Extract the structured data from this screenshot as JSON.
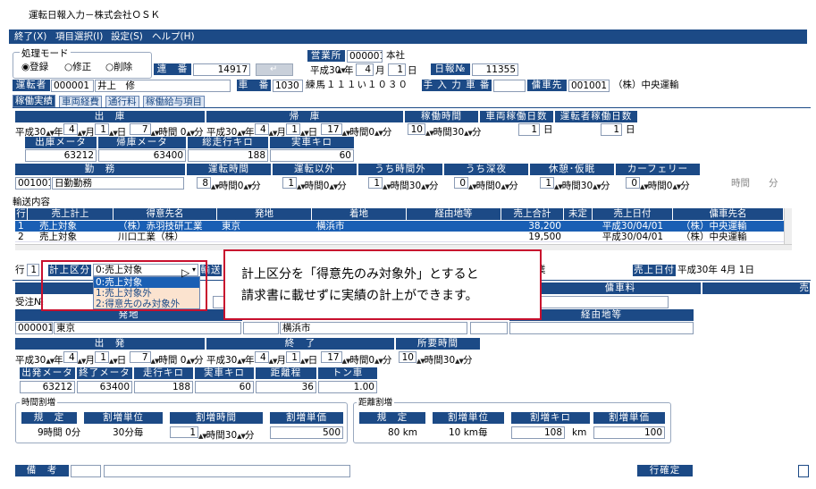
{
  "app": {
    "title": "運転日報入力－株式会社ＯＳＫ"
  },
  "menu": [
    "終了(X)",
    "項目選択(I)",
    "設定(S)",
    "ヘルプ(H)"
  ],
  "mode": {
    "label": "処理モード",
    "opts": [
      "◉登録",
      "○修正",
      "○削除"
    ],
    "serial_label": "連　番",
    "serial": "14917"
  },
  "office": {
    "label": "営業所",
    "code": "000001",
    "name": "本社"
  },
  "date": {
    "era": "平成30",
    "y": "年",
    "m": "4",
    "mu": "月",
    "d": "1",
    "du": "日",
    "report_label": "日報№",
    "report_no": "11355"
  },
  "driver": {
    "label": "運転者",
    "code": "000001",
    "name": "井上　修",
    "car_label": "車　番",
    "car_code": "1030",
    "car_name": "練馬１１１い１０３０",
    "manual_label": "手 入 力 車 番",
    "hire_label": "傭車先",
    "hire_code": "001001",
    "hire_name": "（株）中央運輸"
  },
  "tabs": [
    "稼働実績",
    "車両経費",
    "通行料",
    "稼働給与項目"
  ],
  "top": {
    "h_dep": "出　庫",
    "h_ret": "帰　庫",
    "h_work": "稼働時間",
    "h_vdays": "車両稼働日数",
    "h_ddays": "運転者稼働日数",
    "dep": [
      "平成30",
      "年",
      "4",
      "月",
      "1",
      "日",
      "7",
      "時間",
      "0",
      "分"
    ],
    "ret": [
      "平成30",
      "年",
      "4",
      "月",
      "1",
      "日",
      "17",
      "時間",
      "0",
      "分"
    ],
    "work": [
      "10",
      "時間",
      "30",
      "分"
    ],
    "vdays": "1",
    "vunit": "日",
    "ddays": "1",
    "dunit": "日",
    "h_dm": "出庫メータ",
    "h_rm": "帰庫メータ",
    "h_tk": "総走行キロ",
    "h_ak": "実車キロ",
    "dm": "63212",
    "rm": "63400",
    "tk": "188",
    "ak": "60",
    "h_duty": "勤　務",
    "h_drive": "運転時間",
    "h_other": "運転以外",
    "h_ot": "うち時間外",
    "h_late": "うち深夜",
    "h_rest": "休憩･仮眠",
    "h_ferry": "カーフェリー",
    "duty_code": "001001",
    "duty_name": "日勤勤務",
    "drive": [
      "8",
      "時間",
      "0",
      "分"
    ],
    "other": [
      "1",
      "時間",
      "0",
      "分"
    ],
    "ot": [
      "1",
      "時間",
      "30",
      "分"
    ],
    "late": [
      "0",
      "時間",
      "0",
      "分"
    ],
    "rest": [
      "1",
      "時間",
      "30",
      "分"
    ],
    "ferry": [
      "0",
      "時間",
      "0",
      "分"
    ],
    "ferry2": [
      "時間",
      "分"
    ]
  },
  "grid": {
    "label": "輸送内容",
    "cols": [
      "行",
      "売上計上",
      "得意先名",
      "発地",
      "着地",
      "経由地等",
      "売上合計",
      "未定",
      "売上日付",
      "傭車先名"
    ],
    "rows": [
      [
        "1",
        "売上対象",
        "（株）赤羽技研工業",
        "東京",
        "横浜市",
        "",
        "38,200",
        "",
        "平成30/04/01",
        "（株）中央運輸"
      ],
      [
        "2",
        "売上対象",
        "川口工業（株）",
        "",
        "",
        "",
        "19,500",
        "",
        "平成30/04/01",
        "（株）中央運輸"
      ]
    ]
  },
  "detail": {
    "row_label": "行",
    "row": "1",
    "cls_label": "計上区分",
    "cls_value": "0:売上対象",
    "transport_label": "輸送",
    "options": [
      "0:売上対象",
      "1:売上対象外",
      "2:得意先のみ対象外"
    ],
    "hire_fee_label": "傭車料",
    "sales_label": "売",
    "order_label": "受注№",
    "dep_label": "発地",
    "via_label": "経由地等",
    "dep_code": "000001",
    "dep_name": "東京",
    "arr_name": "横浜市",
    "sales_date_label": "売上日付",
    "sales_date": "平成30",
    "sd_y": "年",
    "sd_m": "4",
    "sd_mu": "月",
    "sd_d": "1",
    "sd_du": "日",
    "trailing": "業"
  },
  "dlow": {
    "h_start": "出　発",
    "h_end": "終　了",
    "h_work": "所要時間",
    "start": [
      "平成30",
      "年",
      "4",
      "月",
      "1",
      "日",
      "7",
      "時間",
      "0",
      "分"
    ],
    "end": [
      "平成30",
      "年",
      "4",
      "月",
      "1",
      "日",
      "17",
      "時間",
      "0",
      "分"
    ],
    "work": [
      "10",
      "時間",
      "30",
      "分"
    ],
    "h_sm": "出発メータ",
    "h_em": "終了メータ",
    "h_run": "走行キロ",
    "h_act": "実車キロ",
    "h_dist": "距離程",
    "h_ton": "トン車",
    "sm": "63212",
    "em": "63400",
    "run": "188",
    "act": "60",
    "dist": "36",
    "ton": "1.00",
    "tw_label": "時間割増",
    "tw_h": [
      "規　定",
      "割増単位",
      "割増時間",
      "割増単価"
    ],
    "tw_v": [
      "9時間 0分",
      "30分毎",
      "1",
      "時間",
      "30",
      "分",
      "500"
    ],
    "dw_label": "距離割増",
    "dw_h": [
      "規　定",
      "割増単位",
      "割増キロ",
      "割増単価"
    ],
    "dw_v": [
      "80 km",
      "10 km毎",
      "108",
      "km",
      "100"
    ]
  },
  "footer": {
    "memo_label": "備　考",
    "confirm": "行確定"
  },
  "callout": {
    "line1": "計上区分を「得意先のみ対象外」とすると",
    "line2": "請求書に載せずに実績の計上ができます。"
  },
  "colors": {
    "header": "#1c4a86",
    "selection": "#1a5fb4",
    "callout_border": "#c8102e",
    "dropdown_bg": "#fbe3cf"
  }
}
